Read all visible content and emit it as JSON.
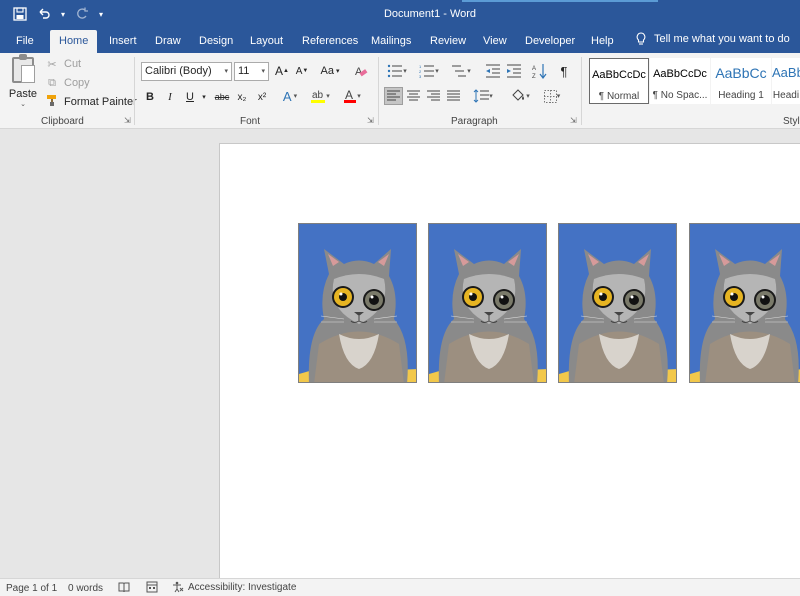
{
  "window": {
    "title": "Document1  -  Word"
  },
  "qat": {
    "save_icon": "save-icon",
    "undo_icon": "undo-icon",
    "redo_icon": "redo-icon",
    "customize_icon": "customize-qat-icon"
  },
  "tabs": [
    {
      "label": "File"
    },
    {
      "label": "Home"
    },
    {
      "label": "Insert"
    },
    {
      "label": "Draw"
    },
    {
      "label": "Design"
    },
    {
      "label": "Layout"
    },
    {
      "label": "References"
    },
    {
      "label": "Mailings"
    },
    {
      "label": "Review"
    },
    {
      "label": "View"
    },
    {
      "label": "Developer"
    },
    {
      "label": "Help"
    }
  ],
  "tell_me": {
    "text": "Tell me what you want to do"
  },
  "clipboard": {
    "group_label": "Clipboard",
    "paste": "Paste",
    "cut": "Cut",
    "copy": "Copy",
    "format_painter": "Format Painter"
  },
  "font": {
    "group_label": "Font",
    "font_name": "Calibri (Body)",
    "font_size": "11",
    "bold": "B",
    "italic": "I",
    "underline": "U",
    "strikethrough": "abc",
    "subscript": "x₂",
    "superscript": "x²",
    "grow": "A",
    "shrink": "A",
    "change_case": "Aa",
    "text_effects": "A",
    "font_color": "A",
    "highlight_color": "#ffff00",
    "font_color_value": "#ff0000"
  },
  "paragraph": {
    "group_label": "Paragraph",
    "show_marks": "¶"
  },
  "styles": {
    "group_label": "Styles",
    "items": [
      {
        "sample": "AaBbCcDc",
        "name": "¶ Normal"
      },
      {
        "sample": "AaBbCcDc",
        "name": "¶ No Spac..."
      },
      {
        "sample": "AaBbCc",
        "name": "Heading 1"
      },
      {
        "sample": "AaBbC",
        "name": "Headi"
      }
    ]
  },
  "document": {
    "images": [
      {
        "alt": "cat with goggles"
      },
      {
        "alt": "cat with goggles"
      },
      {
        "alt": "cat with goggles"
      },
      {
        "alt": "cat with goggles"
      }
    ],
    "image_background": "#4472c4"
  },
  "status": {
    "page": "Page 1 of 1",
    "words": "0 words",
    "accessibility": "Accessibility: Investigate"
  }
}
